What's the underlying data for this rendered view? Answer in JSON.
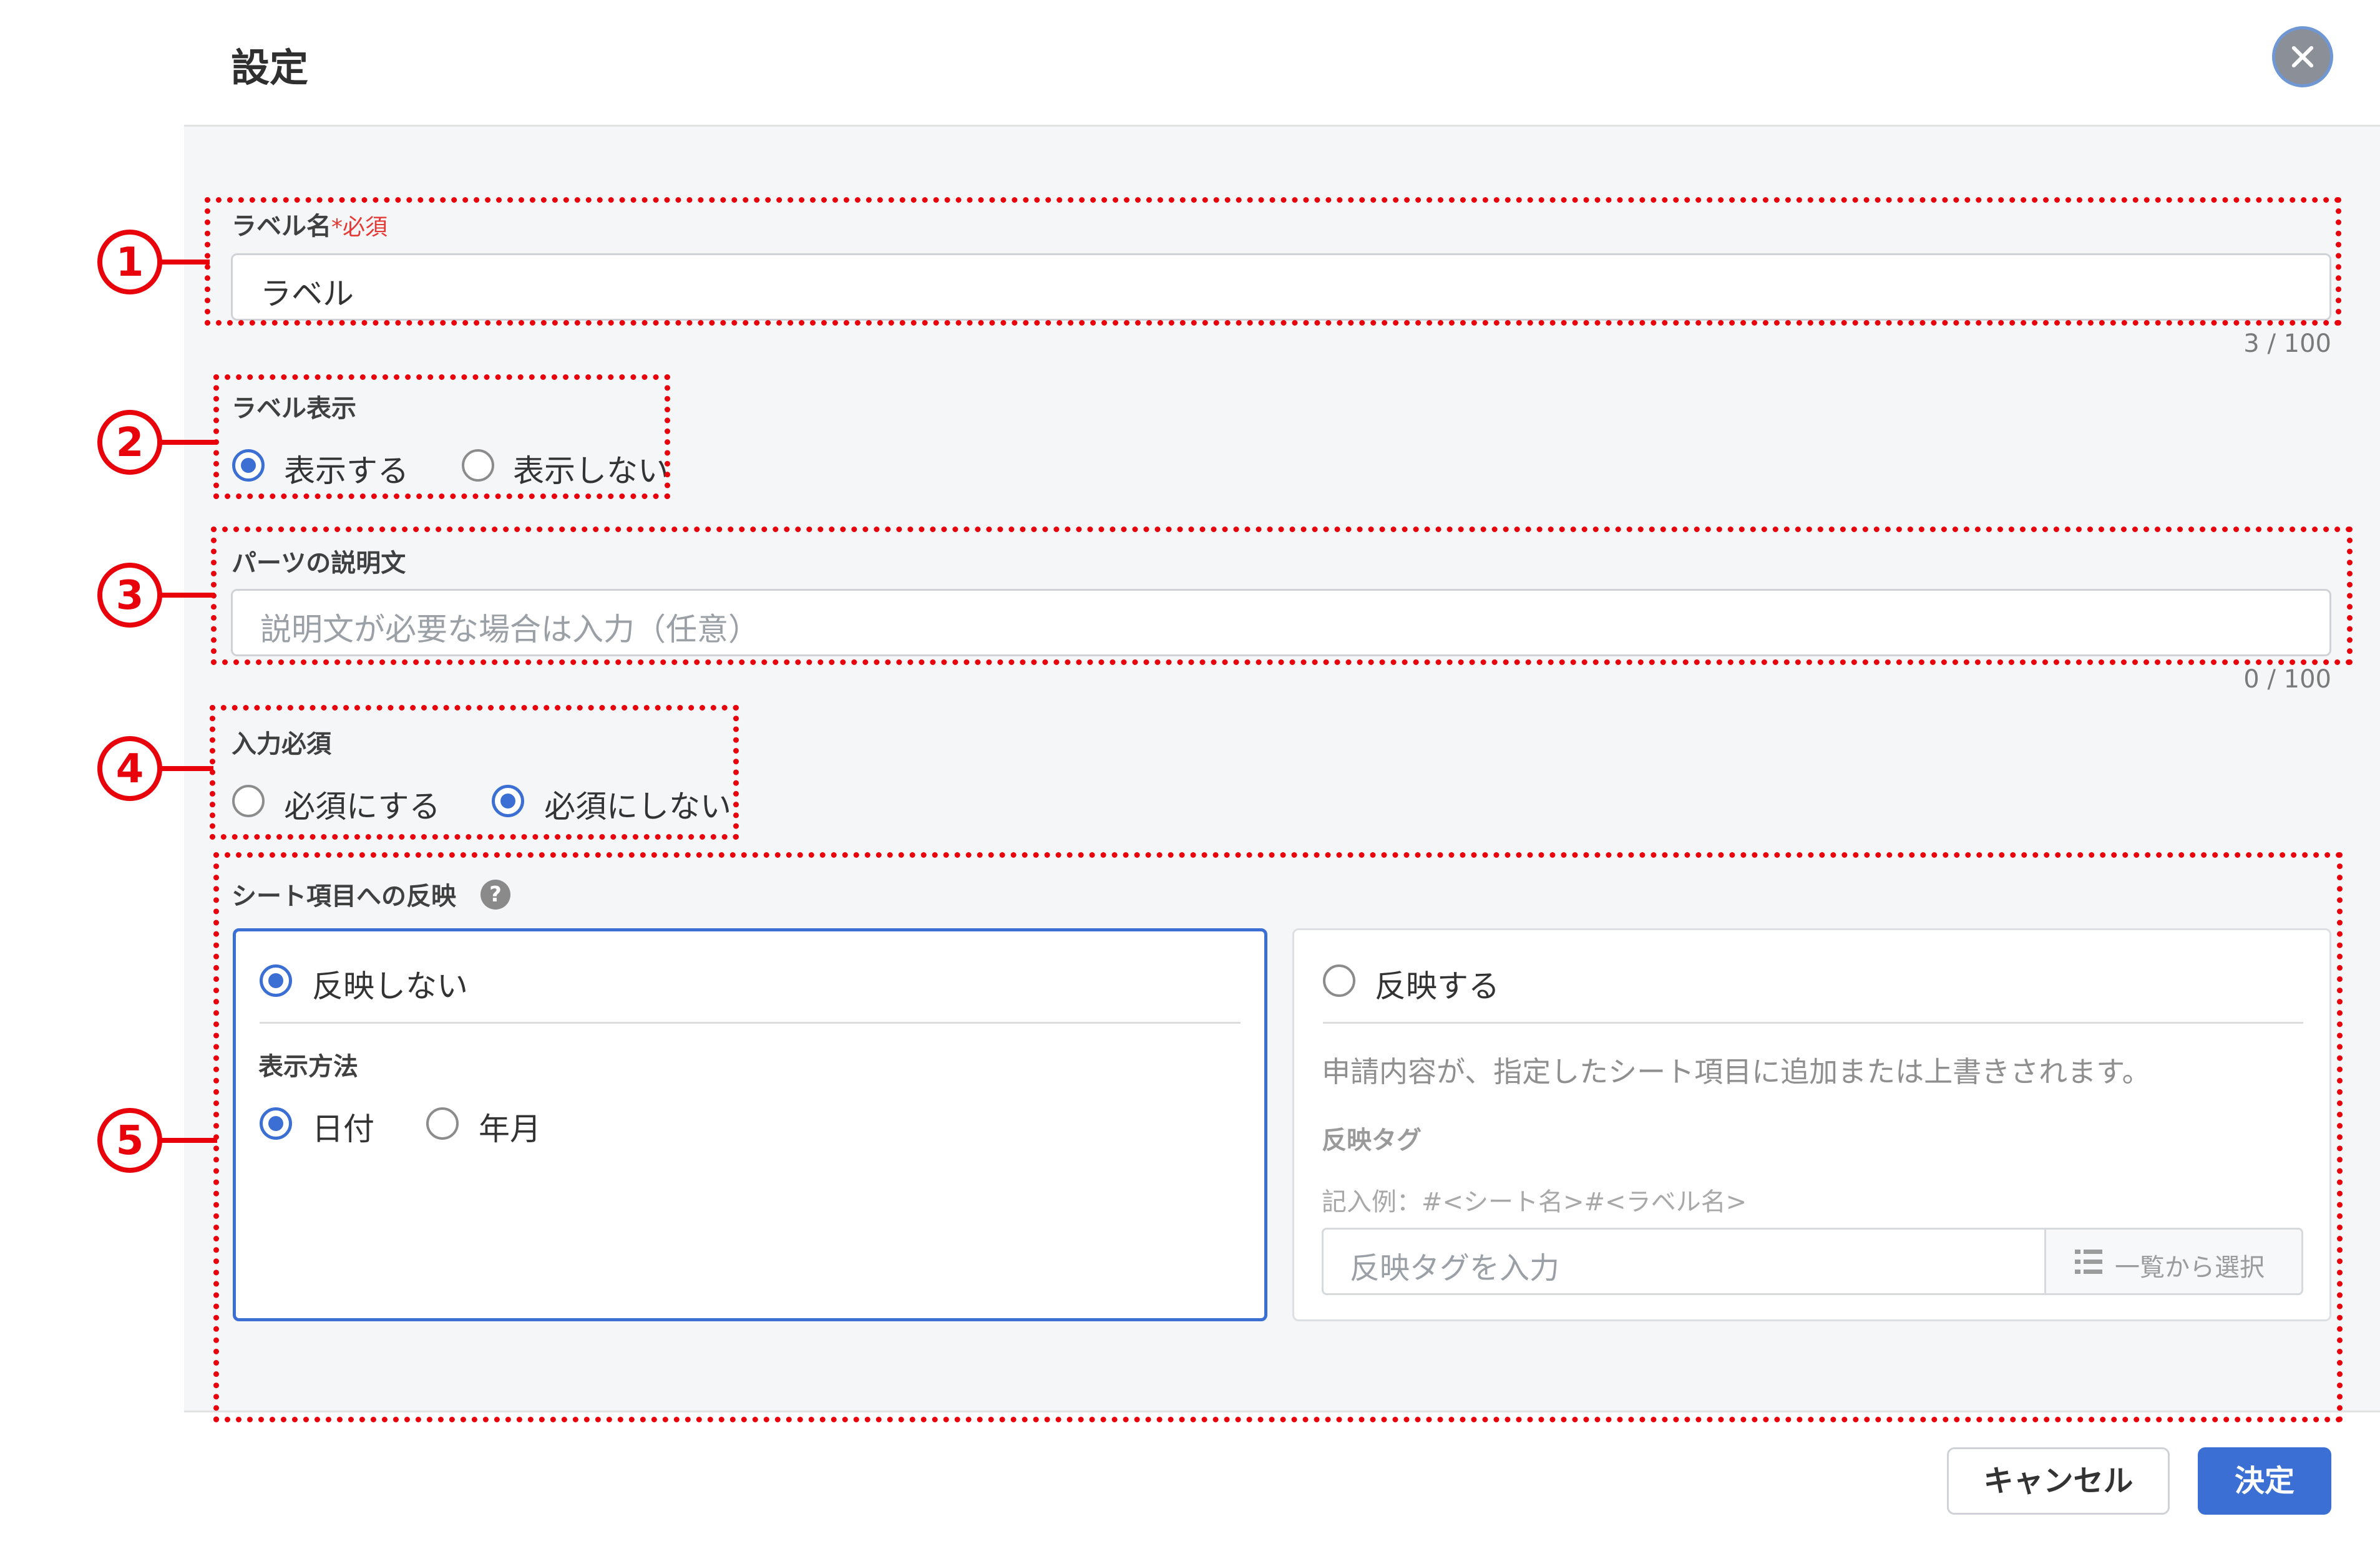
{
  "dialog": {
    "title": "設定",
    "close_icon": "close-icon"
  },
  "label_name": {
    "label": "ラベル名",
    "required_mark": "*必須",
    "value": "ラベル",
    "counter": "3 / 100"
  },
  "label_display": {
    "label": "ラベル表示",
    "options": [
      {
        "label": "表示する",
        "selected": true
      },
      {
        "label": "表示しない",
        "selected": false
      }
    ]
  },
  "description": {
    "label": "パーツの説明文",
    "placeholder": "説明文が必要な場合は入力（任意）",
    "counter": "0 / 100"
  },
  "required": {
    "label": "入力必須",
    "options": [
      {
        "label": "必須にする",
        "selected": false
      },
      {
        "label": "必須にしない",
        "selected": true
      }
    ]
  },
  "sheet_reflection": {
    "label": "シート項目への反映",
    "help_icon": "?",
    "no_reflect": {
      "label": "反映しない",
      "selected": true,
      "display_method_label": "表示方法",
      "display_options": [
        {
          "label": "日付",
          "selected": true
        },
        {
          "label": "年月",
          "selected": false
        }
      ]
    },
    "reflect": {
      "label": "反映する",
      "selected": false,
      "description": "申請内容が、指定したシート項目に追加または上書きされます。",
      "tag_label": "反映タグ",
      "example": "記入例：#<シート名>#<ラベル名>",
      "tag_placeholder": "反映タグを入力",
      "list_button": "一覧から選択"
    }
  },
  "footer": {
    "cancel": "キャンセル",
    "ok": "決定"
  },
  "annotations": {
    "m1": "1",
    "m2": "2",
    "m3": "3",
    "m4": "4",
    "m5": "5"
  },
  "colors": {
    "accent": "#3b6fd4",
    "annotation": "#e8000b",
    "required": "#e53935"
  }
}
